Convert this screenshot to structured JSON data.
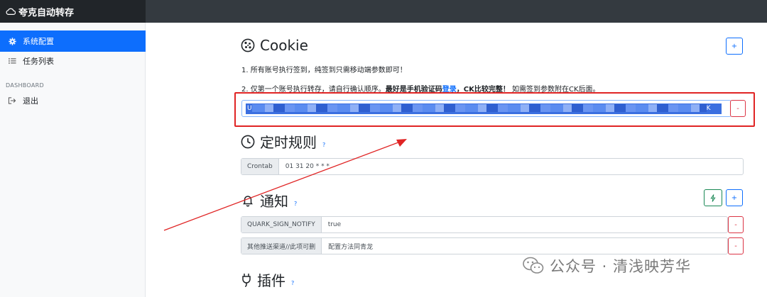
{
  "app": {
    "title": "夸克自动转存"
  },
  "sidebar": {
    "items": [
      {
        "label": "系统配置",
        "icon": "gear-icon",
        "active": true
      },
      {
        "label": "任务列表",
        "icon": "list-icon",
        "active": false
      }
    ],
    "heading": "DASHBOARD",
    "logout": {
      "label": "退出",
      "icon": "logout-icon"
    }
  },
  "cookie": {
    "title": "Cookie",
    "note1": "1. 所有账号执行签到，纯签到只需移动端参数即可！",
    "note2_prefix": "2. 仅第一个账号执行转存，请自行确认顺序。",
    "note2_bold1": "最好是手机验证码",
    "note2_link": "登录",
    "note2_bold2": "，CK比较完整！",
    "note2_suffix": " 如需签到参数附在CK后面。",
    "value_start": "U",
    "value_end": "K",
    "add_label": "+",
    "remove_label": "-"
  },
  "crontab": {
    "title": "定时规则",
    "help": "?",
    "label": "Crontab",
    "value": "01 31 20 * * *"
  },
  "notify": {
    "title": "通知",
    "help": "?",
    "test_icon": "bolt-icon",
    "add_label": "+",
    "rows": [
      {
        "key": "QUARK_SIGN_NOTIFY",
        "value": "true",
        "remove": "-"
      },
      {
        "key": "其他推送渠道//此项可删",
        "value": "配置方法同青龙",
        "remove": "-"
      }
    ]
  },
  "plugins": {
    "title": "插件",
    "help": "?"
  },
  "watermark": {
    "text": "公众号 · 清浅映芳华"
  },
  "colors": {
    "primary": "#0d6efd",
    "annotation": "#e02424",
    "topbar": "#343a40"
  }
}
